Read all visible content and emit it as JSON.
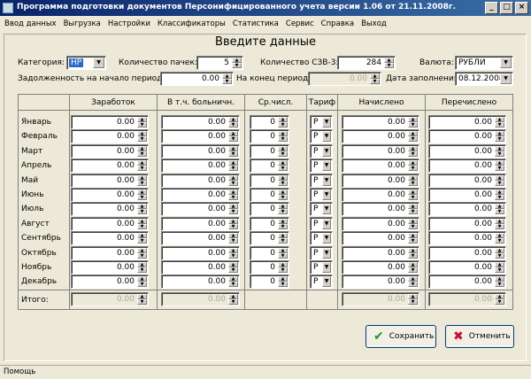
{
  "window": {
    "title": "Программа подготовки документов Персонифицированного учета версии 1.06 от 21.11.2008г.",
    "buttons": [
      "_",
      "□",
      "×"
    ]
  },
  "menu": [
    "Ввод данных",
    "Выгрузка",
    "Настройки",
    "Классификаторы",
    "Статистика",
    "Сервис",
    "Справка",
    "Выход"
  ],
  "heading": "Введите данные",
  "form": {
    "category_label": "Категория:",
    "category_value": "НР",
    "packs_label": "Количество пачек:",
    "packs_value": "5",
    "szv_label": "Количество СЗВ-3:",
    "szv_value": "284",
    "currency_label": "Валюта:",
    "currency_value": "РУБЛИ",
    "debt_start_label": "Задолженность на начало периода:",
    "debt_start_value": "0.00",
    "debt_end_label": "На конец периода:",
    "debt_end_value": "0.00",
    "fill_date_label": "Дата заполнения:",
    "fill_date_value": "08.12.2008"
  },
  "columns": {
    "earnings": "Заработок",
    "sick": "В т.ч. больничн.",
    "avg": "Ср.числ.",
    "tariff": "Тариф",
    "accrued": "Начислено",
    "transferred": "Перечислено"
  },
  "months": [
    "Январь",
    "Февраль",
    "Март",
    "Апрель",
    "Май",
    "Июнь",
    "Июль",
    "Август",
    "Сентябрь",
    "Октябрь",
    "Ноябрь",
    "Декабрь"
  ],
  "rows": [
    {
      "earnings": "0.00",
      "sick": "0.00",
      "avg": "0",
      "tariff": "Р",
      "accrued": "0.00",
      "transferred": "0.00"
    },
    {
      "earnings": "0.00",
      "sick": "0.00",
      "avg": "0",
      "tariff": "Р",
      "accrued": "0.00",
      "transferred": "0.00"
    },
    {
      "earnings": "0.00",
      "sick": "0.00",
      "avg": "0",
      "tariff": "Р",
      "accrued": "0.00",
      "transferred": "0.00"
    },
    {
      "earnings": "0.00",
      "sick": "0.00",
      "avg": "0",
      "tariff": "Р",
      "accrued": "0.00",
      "transferred": "0.00"
    },
    {
      "earnings": "0.00",
      "sick": "0.00",
      "avg": "0",
      "tariff": "Р",
      "accrued": "0.00",
      "transferred": "0.00"
    },
    {
      "earnings": "0.00",
      "sick": "0.00",
      "avg": "0",
      "tariff": "Р",
      "accrued": "0.00",
      "transferred": "0.00"
    },
    {
      "earnings": "0.00",
      "sick": "0.00",
      "avg": "0",
      "tariff": "Р",
      "accrued": "0.00",
      "transferred": "0.00"
    },
    {
      "earnings": "0.00",
      "sick": "0.00",
      "avg": "0",
      "tariff": "Р",
      "accrued": "0.00",
      "transferred": "0.00"
    },
    {
      "earnings": "0.00",
      "sick": "0.00",
      "avg": "0",
      "tariff": "Р",
      "accrued": "0.00",
      "transferred": "0.00"
    },
    {
      "earnings": "0.00",
      "sick": "0.00",
      "avg": "0",
      "tariff": "Р",
      "accrued": "0.00",
      "transferred": "0.00"
    },
    {
      "earnings": "0.00",
      "sick": "0.00",
      "avg": "0",
      "tariff": "Р",
      "accrued": "0.00",
      "transferred": "0.00"
    },
    {
      "earnings": "0.00",
      "sick": "0.00",
      "avg": "0",
      "tariff": "Р",
      "accrued": "0.00",
      "transferred": "0.00"
    }
  ],
  "totals": {
    "label": "Итого:",
    "earnings": "0.00",
    "sick": "0.00",
    "avg": "0",
    "accrued": "0.00",
    "transferred": "0.00"
  },
  "buttons": {
    "save": "Сохранить",
    "cancel": "Отменить"
  },
  "status": "Помощь"
}
